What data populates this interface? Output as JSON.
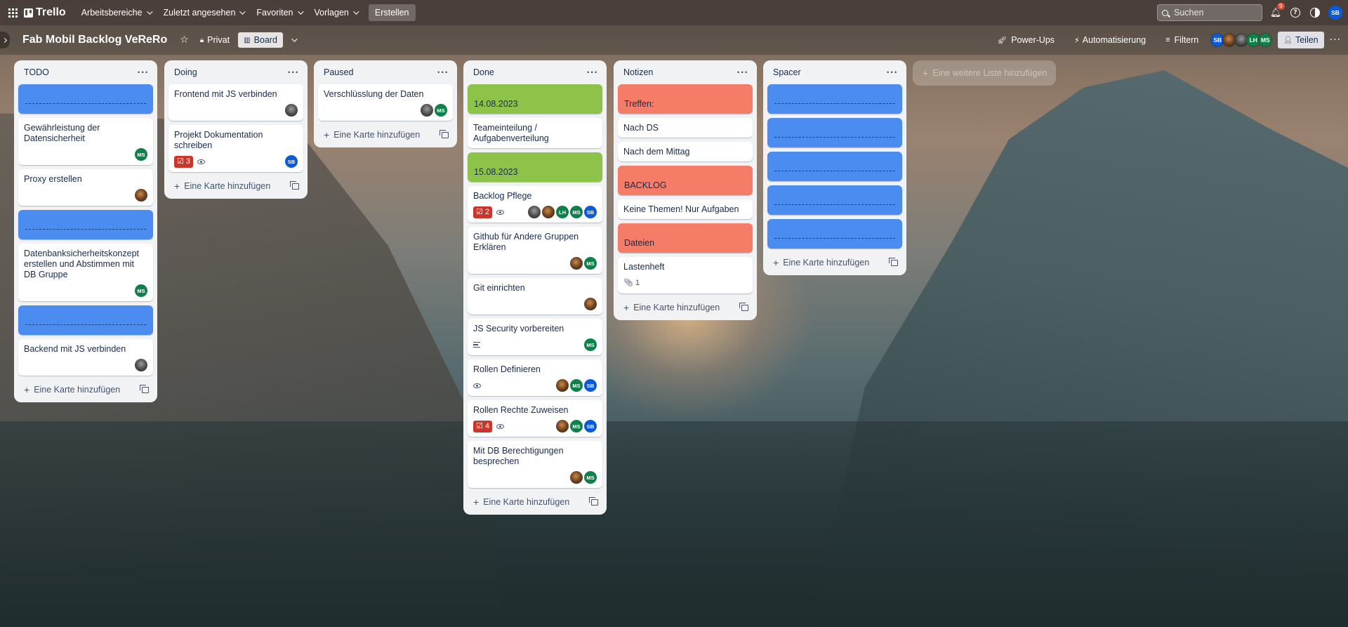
{
  "topbar": {
    "logo": "Trello",
    "nav": [
      "Arbeitsbereiche",
      "Zuletzt angesehen",
      "Favoriten",
      "Vorlagen"
    ],
    "create": "Erstellen",
    "search_placeholder": "Suchen",
    "notification_count": "9",
    "user_initials": "SB"
  },
  "board": {
    "title": "Fab Mobil Backlog VeReRo",
    "visibility": "Privat",
    "view": "Board",
    "power_ups": "Power-Ups",
    "automation": "Automatisierung",
    "filter": "Filtern",
    "members": [
      "SB",
      "",
      "",
      "LH",
      "MS"
    ],
    "share": "Teilen",
    "add_card_label": "Eine Karte hinzufügen",
    "add_list_label": "Eine weitere Liste hinzufügen"
  },
  "colors": {
    "cover_blue": "#4a8cf0",
    "cover_green": "#8ec34a",
    "cover_red": "#f57c66",
    "badge_red": "#c9372c",
    "member_blue": "#0c5ad6",
    "member_green": "#0e8049"
  },
  "lists": [
    {
      "title": "TODO",
      "cards": [
        {
          "cover": "blue",
          "text": ""
        },
        {
          "title": "Gewährleistung der Datensicherheit",
          "members": [
            "MS"
          ]
        },
        {
          "title": "Proxy erstellen",
          "members": [
            "photo-a"
          ]
        },
        {
          "cover": "blue",
          "text": ""
        },
        {
          "title": "Datenbanksicherheitskonzept erstellen und Abstimmen mit DB Gruppe",
          "members": [
            "MS"
          ]
        },
        {
          "cover": "blue",
          "text": ""
        },
        {
          "title": "Backend mit JS verbinden",
          "members": [
            "photo-b"
          ]
        }
      ]
    },
    {
      "title": "Doing",
      "cards": [
        {
          "title": "Frontend mit JS verbinden",
          "members": [
            "photo-b"
          ]
        },
        {
          "title": "Projekt Dokumentation schreiben",
          "checklist": "3",
          "watch": true,
          "members": [
            "SB"
          ]
        }
      ]
    },
    {
      "title": "Paused",
      "cards": [
        {
          "title": "Verschlüsslung der Daten",
          "members": [
            "photo-b",
            "MS"
          ]
        }
      ]
    },
    {
      "title": "Done",
      "cards": [
        {
          "cover": "green",
          "text": "14.08.2023"
        },
        {
          "title": "Teameinteilung / Aufgabenverteilung"
        },
        {
          "cover": "green",
          "text": "15.08.2023"
        },
        {
          "title": "Backlog Pflege",
          "checklist": "2",
          "watch": true,
          "members": [
            "photo-b",
            "photo-a",
            "LH",
            "MS",
            "SB"
          ]
        },
        {
          "title": "Github für Andere Gruppen Erklären",
          "members": [
            "photo-a",
            "MS"
          ]
        },
        {
          "title": "Git einrichten",
          "members": [
            "photo-a"
          ]
        },
        {
          "title": "JS Security vorbereiten",
          "description": true,
          "members": [
            "MS"
          ]
        },
        {
          "title": "Rollen Definieren",
          "watch": true,
          "members": [
            "photo-a",
            "MS",
            "SB"
          ]
        },
        {
          "title": "Rollen Rechte Zuweisen",
          "checklist": "4",
          "watch": true,
          "members": [
            "photo-a",
            "MS",
            "SB"
          ]
        },
        {
          "title": "Mit DB Berechtigungen besprechen",
          "members": [
            "photo-a",
            "MS"
          ]
        }
      ]
    },
    {
      "title": "Notizen",
      "cards": [
        {
          "cover": "red",
          "text": "Treffen:"
        },
        {
          "title": "Nach DS"
        },
        {
          "title": "Nach dem Mittag"
        },
        {
          "cover": "red",
          "text": "BACKLOG"
        },
        {
          "title": "Keine Themen! Nur Aufgaben"
        },
        {
          "cover": "red",
          "text": "Dateien"
        },
        {
          "title": "Lastenheft",
          "attachments": "1"
        }
      ]
    },
    {
      "title": "Spacer",
      "cards": [
        {
          "cover": "blue",
          "text": ""
        },
        {
          "cover": "blue",
          "text": ""
        },
        {
          "cover": "blue",
          "text": ""
        },
        {
          "cover": "blue",
          "text": ""
        },
        {
          "cover": "blue",
          "text": ""
        }
      ]
    }
  ]
}
